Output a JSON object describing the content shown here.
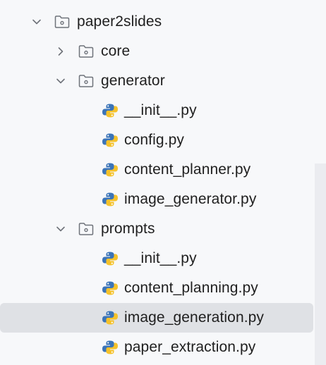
{
  "project_tree": {
    "root": {
      "label": "paper2slides",
      "icon": "folder-icon",
      "expanded": true
    },
    "core": {
      "label": "core",
      "icon": "folder-icon",
      "expanded": false
    },
    "generator": {
      "label": "generator",
      "icon": "folder-icon",
      "expanded": true,
      "files": [
        {
          "label": "__init__.py",
          "icon": "python-file-icon"
        },
        {
          "label": "config.py",
          "icon": "python-file-icon"
        },
        {
          "label": "content_planner.py",
          "icon": "python-file-icon"
        },
        {
          "label": "image_generator.py",
          "icon": "python-file-icon"
        }
      ]
    },
    "prompts": {
      "label": "prompts",
      "icon": "folder-icon",
      "expanded": true,
      "files": [
        {
          "label": "__init__.py",
          "icon": "python-file-icon"
        },
        {
          "label": "content_planning.py",
          "icon": "python-file-icon"
        },
        {
          "label": "image_generation.py",
          "icon": "python-file-icon",
          "selected": true
        },
        {
          "label": "paper_extraction.py",
          "icon": "python-file-icon"
        }
      ]
    }
  },
  "colors": {
    "background": "#f7f8fa",
    "selection": "#dfe1e5",
    "text": "#1f1f1f",
    "python_blue": "#3b74b8",
    "python_yellow": "#f5c22b"
  }
}
